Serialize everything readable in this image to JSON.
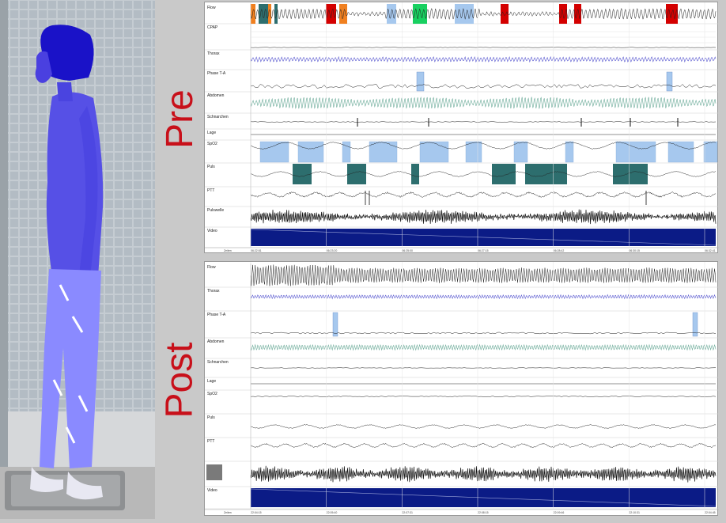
{
  "pre": {
    "title": "Pre",
    "channels": [
      {
        "id": "flow",
        "label": "Flow"
      },
      {
        "id": "cpap",
        "label": "CPAP"
      },
      {
        "id": "thorax",
        "label": "Thorax"
      },
      {
        "id": "phase",
        "label": "Phase T-A"
      },
      {
        "id": "abdomen",
        "label": "Abdomen"
      },
      {
        "id": "snore",
        "label": "Schnarchen"
      },
      {
        "id": "position",
        "label": "Lage"
      },
      {
        "id": "spo2",
        "label": "SpO2"
      },
      {
        "id": "pulse",
        "label": "Puls"
      },
      {
        "id": "ptt",
        "label": "PTT"
      },
      {
        "id": "pleth",
        "label": "Pulswelle"
      },
      {
        "id": "video",
        "label": "Video"
      }
    ],
    "time_label": "Zeiten",
    "times": [
      "06:22:51",
      "06:23:20",
      "06:25:00",
      "06:27:15",
      "06:28:42",
      "06:30:15",
      "06:32:41"
    ]
  },
  "post": {
    "title": "Post",
    "channels": [
      {
        "id": "flow",
        "label": "Flow"
      },
      {
        "id": "thorax",
        "label": "Thorax"
      },
      {
        "id": "phase",
        "label": "Phase T-A"
      },
      {
        "id": "abdomen",
        "label": "Abdomen"
      },
      {
        "id": "snore",
        "label": "Schnarchen"
      },
      {
        "id": "position",
        "label": "Lage"
      },
      {
        "id": "spo2",
        "label": "SpO2"
      },
      {
        "id": "pulse",
        "label": "Puls"
      },
      {
        "id": "ptt",
        "label": "PTT"
      },
      {
        "id": "pleth",
        "label": ""
      },
      {
        "id": "video",
        "label": "Video"
      }
    ],
    "time_label": "Zeiten",
    "times": [
      "22:04:15",
      "22:05:40",
      "22:07:31",
      "22:08:15",
      "22:09:46",
      "22:10:31",
      "22:04:45"
    ]
  },
  "colors": {
    "red": "#d40000",
    "orange": "#f08020",
    "teal": "#2d6e6e",
    "green": "#18d060",
    "lightblue": "#a6c8ee",
    "navy": "#0b1b86",
    "thorax": "#5a5ad0",
    "abdomen": "#6aaa98",
    "label": "#c8101a"
  }
}
